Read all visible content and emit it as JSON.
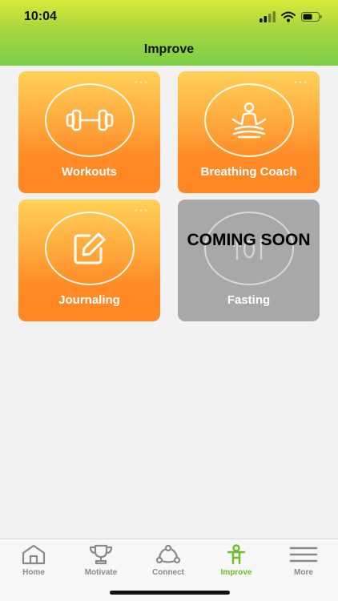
{
  "status": {
    "time": "10:04"
  },
  "header": {
    "title": "Improve"
  },
  "tiles": [
    {
      "label": "Workouts",
      "icon": "dumbbell-icon",
      "more": "···"
    },
    {
      "label": "Breathing Coach",
      "icon": "meditation-icon",
      "more": "···"
    },
    {
      "label": "Journaling",
      "icon": "edit-icon",
      "more": "···"
    },
    {
      "label": "Fasting",
      "icon": "cutlery-icon",
      "overlay": "COMING SOON"
    }
  ],
  "tabbar": {
    "items": [
      {
        "label": "Home",
        "icon": "home-icon"
      },
      {
        "label": "Motivate",
        "icon": "trophy-icon"
      },
      {
        "label": "Connect",
        "icon": "connect-icon"
      },
      {
        "label": "Improve",
        "icon": "person-icon",
        "active": true
      },
      {
        "label": "More",
        "icon": "menu-icon"
      }
    ]
  },
  "colors": {
    "header_top": "#d8e93a",
    "header_bottom": "#7ccf48",
    "tile_top": "#ffd159",
    "tile_bottom": "#ff8624",
    "tile_disabled": "#a8a8a8",
    "active_tab": "#6bbf2a",
    "inactive_tab": "#8a8a8a"
  }
}
